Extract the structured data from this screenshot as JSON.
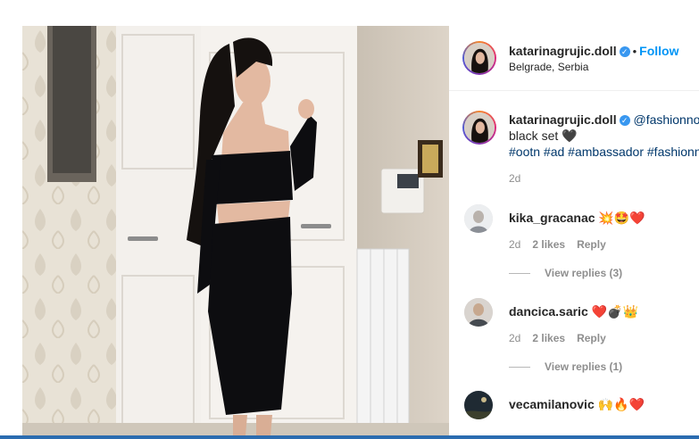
{
  "post": {
    "author": "katarinagrujic.doll",
    "location": "Belgrade, Serbia",
    "follow_label": "Follow",
    "dot": "•",
    "verified_mark": "✓"
  },
  "caption": {
    "author": "katarinagrujic.doll",
    "mention": "@fashionnov",
    "text": "black set 🖤",
    "hashtags": "#ootn #ad #ambassador #fashionn",
    "time": "2d"
  },
  "comments": [
    {
      "user": "kika_gracanac",
      "emoji": "💥🤩❤️",
      "time": "2d",
      "likes": "2 likes",
      "reply": "Reply",
      "view_replies": "View replies (3)"
    },
    {
      "user": "dancica.saric",
      "emoji": "❤️💣👑",
      "time": "2d",
      "likes": "2 likes",
      "reply": "Reply",
      "view_replies": "View replies (1)"
    },
    {
      "user": "vecamilanovic",
      "emoji": "🙌🔥❤️"
    }
  ],
  "icons": {
    "verified": "verified-badge-icon"
  },
  "colors": {
    "link": "#0095f6",
    "hashtag": "#00376b",
    "muted": "#8e8e8e",
    "bottom_bar": "#2b6cb0"
  }
}
